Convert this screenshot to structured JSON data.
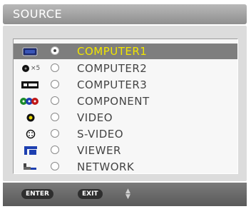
{
  "title": "SOURCE",
  "sources": [
    {
      "label": "COMPUTER1",
      "icon": "computer1-connector-icon",
      "selected": true
    },
    {
      "label": "COMPUTER2",
      "icon": "computer2-x5-connector-icon",
      "icon_text": "×5",
      "selected": false
    },
    {
      "label": "COMPUTER3",
      "icon": "computer3-dvi-connector-icon",
      "selected": false
    },
    {
      "label": "COMPONENT",
      "icon": "component-rgb-connector-icon",
      "selected": false
    },
    {
      "label": "VIDEO",
      "icon": "video-rca-connector-icon",
      "selected": false
    },
    {
      "label": "S-VIDEO",
      "icon": "s-video-connector-icon",
      "selected": false
    },
    {
      "label": "VIEWER",
      "icon": "viewer-usb-icon",
      "selected": false
    },
    {
      "label": "NETWORK",
      "icon": "network-lan-icon",
      "selected": false
    }
  ],
  "footer": {
    "enter_label": "ENTER",
    "exit_label": "EXIT",
    "nav_icon": "up-down-arrows-icon"
  },
  "colors": {
    "selected_text": "#f2e600",
    "selected_row": "#7e7e7e",
    "title_bar": "#a6a6a6",
    "panel": "#dcdcdc"
  }
}
